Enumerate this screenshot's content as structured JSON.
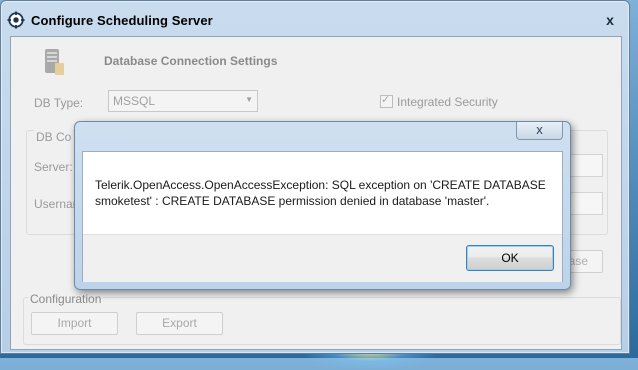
{
  "window": {
    "title": "Configure Scheduling Server",
    "close_glyph": "x",
    "icon": "gear-icon"
  },
  "header": {
    "title": "Database Connection Settings",
    "icon": "server-icon"
  },
  "db_type": {
    "label": "DB Type:",
    "value": "MSSQL"
  },
  "integrated_security": {
    "label": "Integrated Security",
    "checked": true
  },
  "connection_group": {
    "legend": "DB Co",
    "server_label": "Server:",
    "username_label": "Usernam"
  },
  "background_button": {
    "label": "base"
  },
  "configuration": {
    "legend": "Configuration",
    "import_label": "Import",
    "export_label": "Export"
  },
  "dialog": {
    "message": "Telerik.OpenAccess.OpenAccessException: SQL exception on 'CREATE DATABASE smoketest' : CREATE DATABASE permission denied in database 'master'.",
    "ok_label": "OK",
    "close_glyph": "x"
  }
}
